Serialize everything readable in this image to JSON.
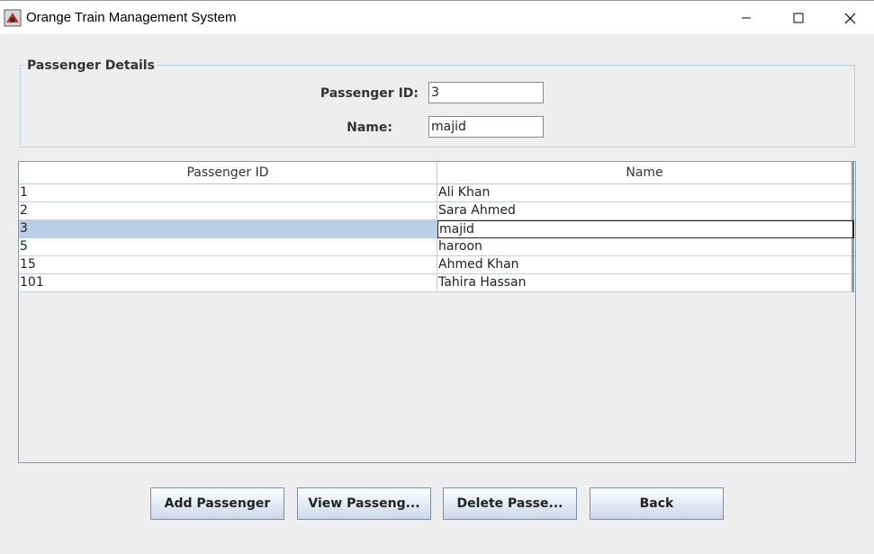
{
  "window": {
    "title": "Orange Train Management System",
    "app_icon": "train-app-icon",
    "controls": [
      "minimize-icon",
      "maximize-icon",
      "close-icon"
    ]
  },
  "details": {
    "group_title": "Passenger Details",
    "id_label": "Passenger ID:",
    "id_value": "3",
    "name_label": "Name:",
    "name_value": "majid"
  },
  "table": {
    "columns": [
      "Passenger ID",
      "Name"
    ],
    "rows": [
      {
        "id": "1",
        "name": "Ali Khan"
      },
      {
        "id": "2",
        "name": "Sara Ahmed"
      },
      {
        "id": "3",
        "name": "majid"
      },
      {
        "id": "5",
        "name": "haroon"
      },
      {
        "id": "15",
        "name": "Ahmed Khan"
      },
      {
        "id": "101",
        "name": "Tahira Hassan"
      }
    ],
    "selected_row": 2
  },
  "buttons": {
    "add": "Add Passenger",
    "view": "View Passeng...",
    "delete": "Delete Passe...",
    "back": "Back"
  },
  "colors": {
    "selection": "#b8cfe5",
    "button_gradient_bottom": "#cbd8ea"
  }
}
